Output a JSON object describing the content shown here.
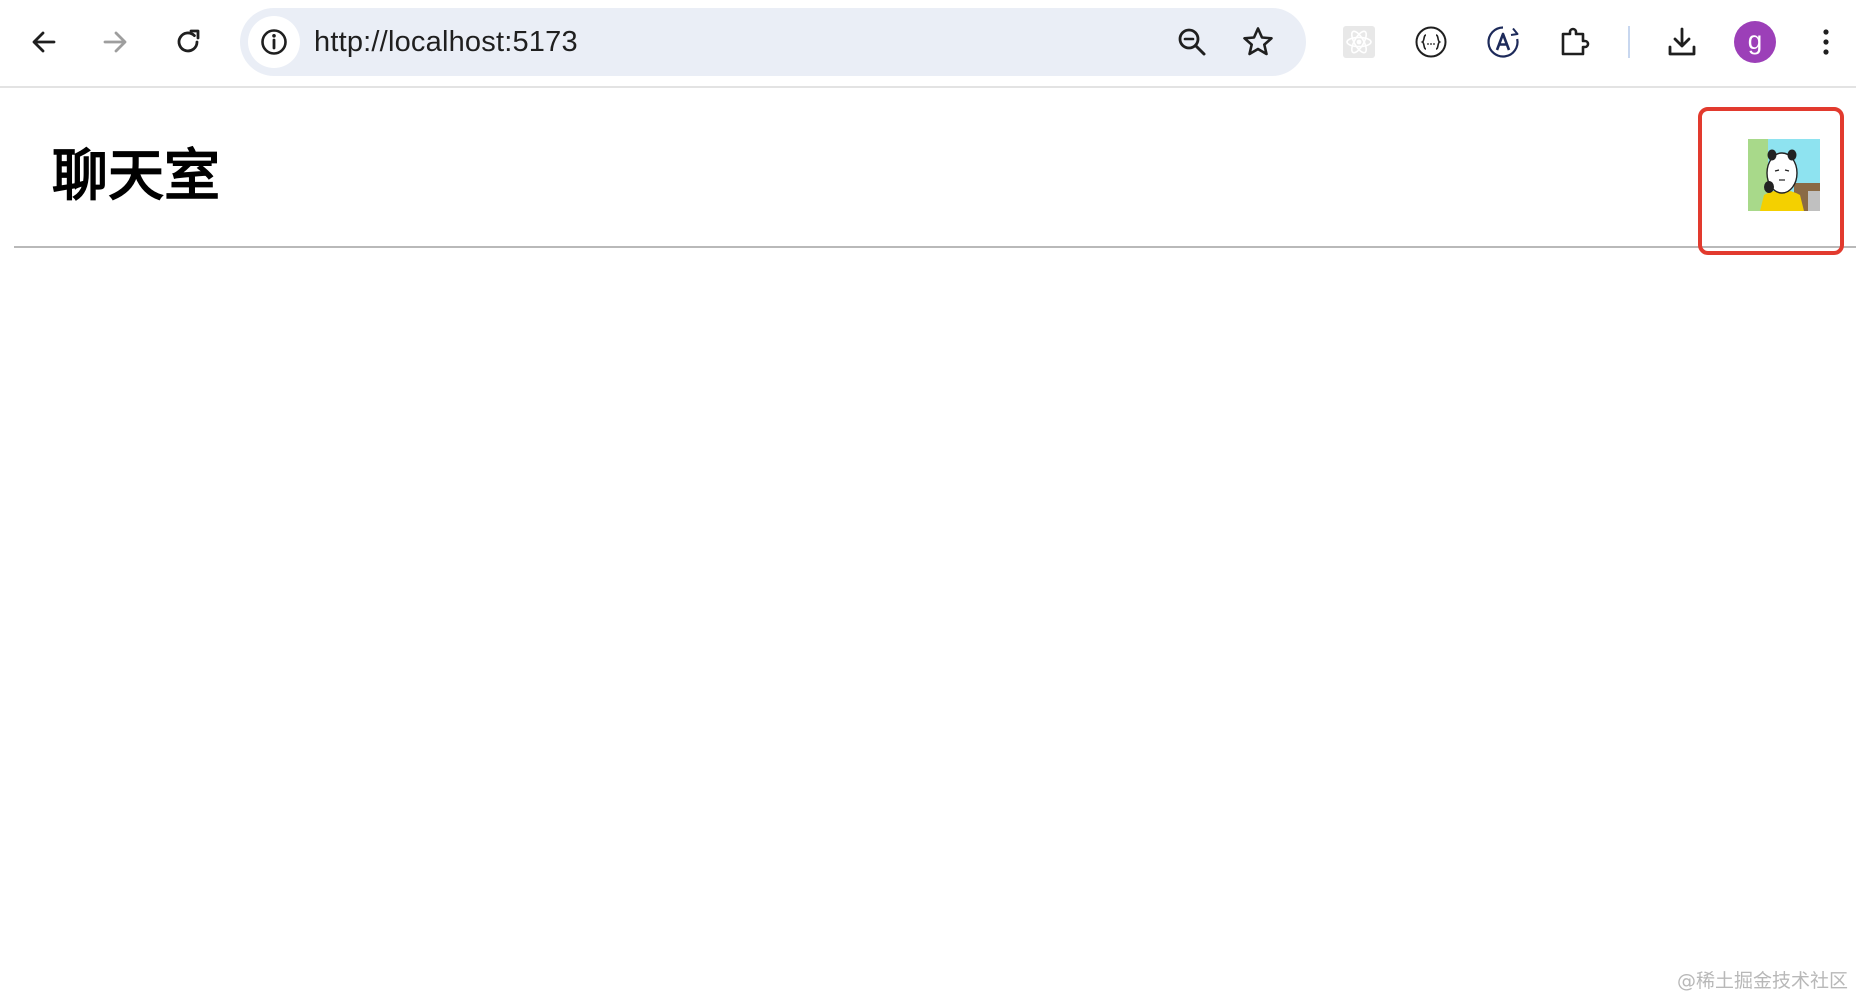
{
  "browser": {
    "url": "http://localhost:5173",
    "profile_initial": "g",
    "profile_color": "#9c3fb8",
    "icons": {
      "back": "back-arrow-icon",
      "forward": "forward-arrow-icon",
      "reload": "reload-icon",
      "site_info": "info-icon",
      "zoom": "zoom-icon",
      "bookmark": "star-icon",
      "react_devtools": "react-icon",
      "json_viewer": "braces-icon",
      "translate": "a-letter-icon",
      "extensions": "puzzle-icon",
      "downloads": "download-icon",
      "menu": "kebab-menu-icon"
    }
  },
  "page": {
    "title": "聊天室",
    "avatar_highlight_color": "#e23a2e"
  },
  "watermark": "@稀土掘金技术社区"
}
